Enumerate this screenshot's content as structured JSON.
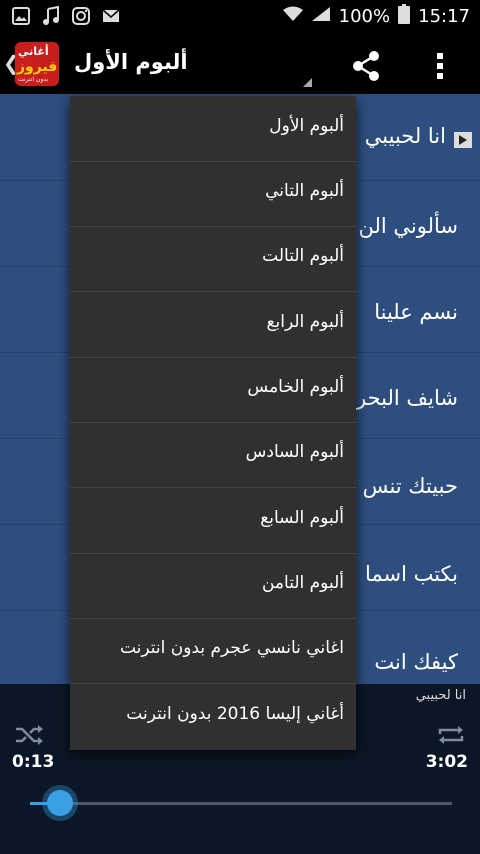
{
  "status_bar": {
    "battery_percent": "100%",
    "time": "15:17",
    "left_icons": [
      "image-icon",
      "music-note-icon",
      "instagram-icon",
      "mail-icon"
    ],
    "right_icons": [
      "wifi-icon",
      "signal-icon",
      "battery-icon"
    ]
  },
  "app_bar": {
    "logo": {
      "line1": "أغاني",
      "line2": "فيروز",
      "line3": "بدون انترنت"
    },
    "title": "ألبوم الأول",
    "share_icon": "share-icon",
    "more_icon": "more-vert-icon"
  },
  "songs": [
    {
      "title": "انا لحبيبي",
      "playing": true
    },
    {
      "title": "سألوني الن",
      "playing": false
    },
    {
      "title": "نسم علينا",
      "playing": false
    },
    {
      "title": "شايف البحر",
      "playing": false
    },
    {
      "title": "حبيتك تنس",
      "playing": false
    },
    {
      "title": "بكتب اسما",
      "playing": false
    },
    {
      "title": "كيفك انت",
      "playing": false
    }
  ],
  "dropdown": {
    "items": [
      "ألبوم الأول",
      "ألبوم التاني",
      "ألبوم التالت",
      "ألبوم الرابع",
      "ألبوم الخامس",
      "ألبوم السادس",
      "ألبوم السابع",
      "ألبوم التامن",
      "اغاني نانسي عجرم بدون انترنت",
      "أغاني إليسا 2016 بدون انترنت"
    ]
  },
  "player": {
    "now_playing": "انا لحبيبي",
    "current_time": "0:13",
    "total_time": "3:02",
    "progress_fraction": 0.07,
    "accent_color": "#3aa0e6"
  }
}
